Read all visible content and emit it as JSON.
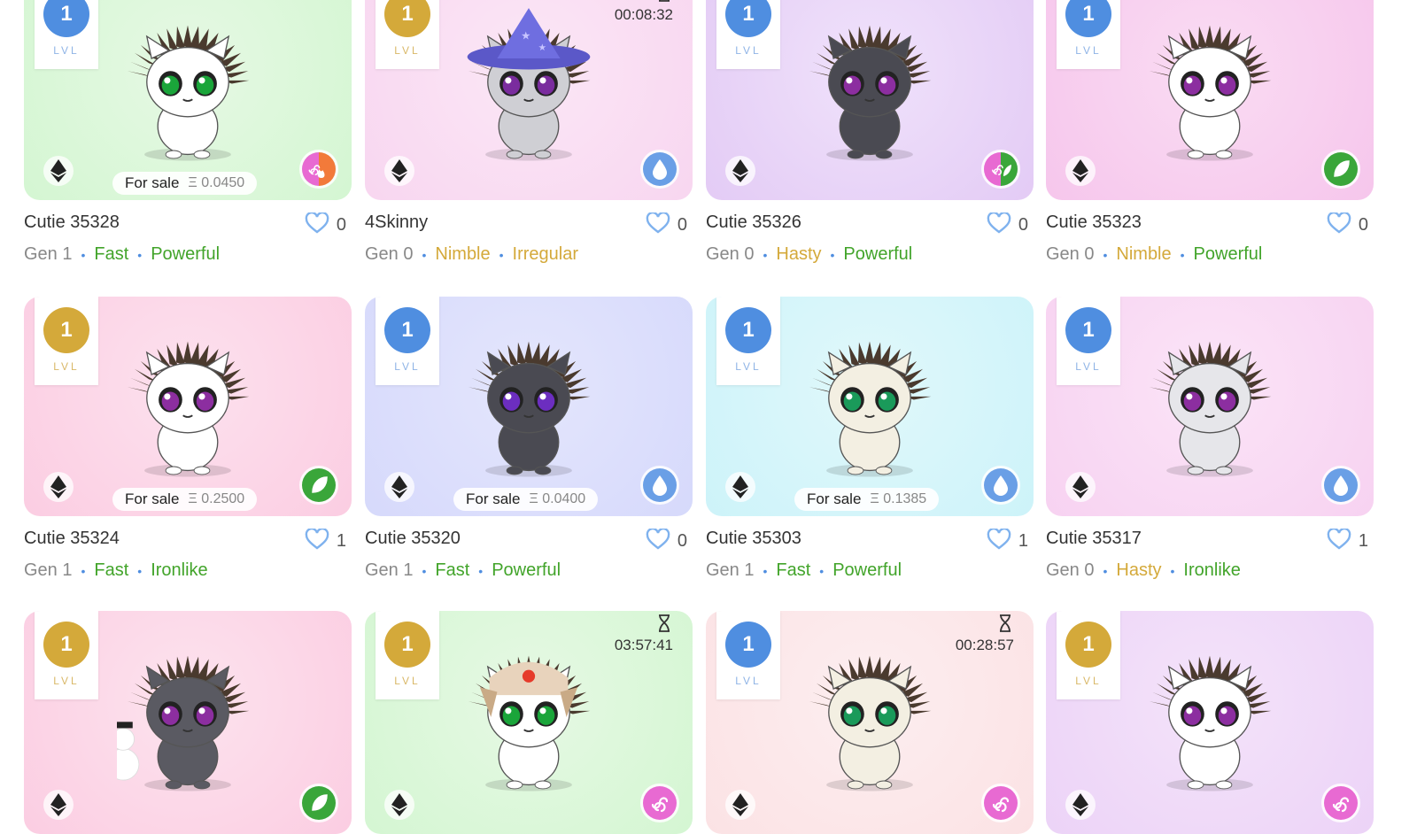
{
  "cards": [
    {
      "level": "1",
      "lvl_label": "LVL",
      "lvl_color": "blue",
      "bg": "#d4f6d2",
      "bg2": "#e6f9e4",
      "timer": "",
      "for_sale": "For sale",
      "price": "Ξ 0.0450",
      "name": "Cutie 35328",
      "likes": "0",
      "gen": "Gen 1",
      "trait1": "Fast",
      "trait1_color": "green",
      "trait2": "Powerful",
      "trait2_color": "green",
      "element": "wind-fire",
      "element_icon": "wind-fire-icon",
      "fur": "#ffffff",
      "eyes": "#1aa53a"
    },
    {
      "level": "1",
      "lvl_label": "LVL",
      "lvl_color": "gold",
      "bg": "#f8d6f0",
      "bg2": "#fbe7f6",
      "timer": "00:08:32",
      "for_sale": "",
      "price": "",
      "name": "4Skinny",
      "likes": "0",
      "gen": "Gen 0",
      "trait1": "Nimble",
      "trait1_color": "gold",
      "trait2": "Irregular",
      "trait2_color": "gold",
      "element": "water",
      "element_icon": "water-drop-icon",
      "fur": "#cfcfd4",
      "eyes": "#7a2c9e",
      "hat": "wizard"
    },
    {
      "level": "1",
      "lvl_label": "LVL",
      "lvl_color": "blue",
      "bg": "#e3cbf5",
      "bg2": "#f0e2fb",
      "timer": "",
      "for_sale": "",
      "price": "",
      "name": "Cutie 35326",
      "likes": "0",
      "gen": "Gen 0",
      "trait1": "Hasty",
      "trait1_color": "gold",
      "trait2": "Powerful",
      "trait2_color": "green",
      "element": "wind-earth",
      "element_icon": "wind-leaf-icon",
      "fur": "#4a4a52",
      "eyes": "#8c2ea0"
    },
    {
      "level": "1",
      "lvl_label": "LVL",
      "lvl_color": "blue",
      "bg": "#f6c6ec",
      "bg2": "#fadcf3",
      "timer": "",
      "for_sale": "",
      "price": "",
      "name": "Cutie 35323",
      "likes": "0",
      "gen": "Gen 0",
      "trait1": "Nimble",
      "trait1_color": "gold",
      "trait2": "Powerful",
      "trait2_color": "green",
      "element": "earth",
      "element_icon": "leaf-icon",
      "fur": "#ffffff",
      "eyes": "#8c2ea0"
    },
    {
      "level": "1",
      "lvl_label": "LVL",
      "lvl_color": "gold",
      "bg": "#fbcde2",
      "bg2": "#fde1ee",
      "timer": "",
      "for_sale": "For sale",
      "price": "Ξ 0.2500",
      "name": "Cutie 35324",
      "likes": "1",
      "gen": "Gen 1",
      "trait1": "Fast",
      "trait1_color": "green",
      "trait2": "Ironlike",
      "trait2_color": "green",
      "element": "earth",
      "element_icon": "leaf-icon",
      "fur": "#ffffff",
      "eyes": "#8c2ea0"
    },
    {
      "level": "1",
      "lvl_label": "LVL",
      "lvl_color": "blue",
      "bg": "#d6d9fb",
      "bg2": "#e4e6fd",
      "timer": "",
      "for_sale": "For sale",
      "price": "Ξ 0.0400",
      "name": "Cutie 35320",
      "likes": "0",
      "gen": "Gen 1",
      "trait1": "Fast",
      "trait1_color": "green",
      "trait2": "Powerful",
      "trait2_color": "green",
      "element": "water",
      "element_icon": "water-drop-icon",
      "fur": "#4a4a52",
      "eyes": "#6c2ec0"
    },
    {
      "level": "1",
      "lvl_label": "LVL",
      "lvl_color": "blue",
      "bg": "#cdf3f9",
      "bg2": "#e0f8fb",
      "timer": "",
      "for_sale": "For sale",
      "price": "Ξ 0.1385",
      "name": "Cutie 35303",
      "likes": "1",
      "gen": "Gen 1",
      "trait1": "Fast",
      "trait1_color": "green",
      "trait2": "Powerful",
      "trait2_color": "green",
      "element": "water",
      "element_icon": "water-drop-icon",
      "fur": "#f3efe2",
      "eyes": "#1a9a5a"
    },
    {
      "level": "1",
      "lvl_label": "LVL",
      "lvl_color": "blue",
      "bg": "#f7d2f1",
      "bg2": "#fbe4f7",
      "timer": "",
      "for_sale": "",
      "price": "",
      "name": "Cutie 35317",
      "likes": "1",
      "gen": "Gen 0",
      "trait1": "Hasty",
      "trait1_color": "gold",
      "trait2": "Ironlike",
      "trait2_color": "green",
      "element": "water",
      "element_icon": "water-drop-icon",
      "fur": "#e6e6ea",
      "eyes": "#8c2ea0"
    },
    {
      "level": "1",
      "lvl_label": "LVL",
      "lvl_color": "gold",
      "bg": "#fbcde2",
      "bg2": "#fde3ee",
      "timer": "",
      "for_sale": "",
      "price": "",
      "name": "",
      "likes": "",
      "gen": "",
      "trait1": "",
      "trait1_color": "green",
      "trait2": "",
      "trait2_color": "green",
      "element": "earth",
      "element_icon": "leaf-icon",
      "fur": "#5a5a62",
      "eyes": "#8c2ea0",
      "hat": "snowman"
    },
    {
      "level": "1",
      "lvl_label": "LVL",
      "lvl_color": "gold",
      "bg": "#d4f6d2",
      "bg2": "#e6f9e4",
      "timer": "03:57:41",
      "for_sale": "",
      "price": "",
      "name": "",
      "likes": "",
      "gen": "",
      "trait1": "",
      "trait1_color": "green",
      "trait2": "",
      "trait2_color": "green",
      "element": "wind",
      "element_icon": "wind-icon",
      "fur": "#ffffff",
      "eyes": "#1aa53a",
      "hat": "ushanka"
    },
    {
      "level": "1",
      "lvl_label": "LVL",
      "lvl_color": "blue",
      "bg": "#fbe2e4",
      "bg2": "#fdeef0",
      "timer": "00:28:57",
      "for_sale": "",
      "price": "",
      "name": "",
      "likes": "",
      "gen": "",
      "trait1": "",
      "trait1_color": "green",
      "trait2": "",
      "trait2_color": "green",
      "element": "wind",
      "element_icon": "wind-icon",
      "fur": "#f3efe2",
      "eyes": "#1a9a5a"
    },
    {
      "level": "1",
      "lvl_label": "LVL",
      "lvl_color": "gold",
      "bg": "#ecd3f7",
      "bg2": "#f4e3fa",
      "timer": "",
      "for_sale": "",
      "price": "",
      "name": "",
      "likes": "",
      "gen": "",
      "trait1": "",
      "trait1_color": "green",
      "trait2": "",
      "trait2_color": "green",
      "element": "wind",
      "element_icon": "wind-icon",
      "fur": "#ffffff",
      "eyes": "#8c2ea0"
    }
  ],
  "colors": {
    "green": "#42a42a",
    "gold": "#d4a93a",
    "blue": "#4f8ee0"
  },
  "icons": {
    "currency": "ethereum-icon",
    "like": "heart-icon",
    "timer": "hourglass-icon"
  }
}
